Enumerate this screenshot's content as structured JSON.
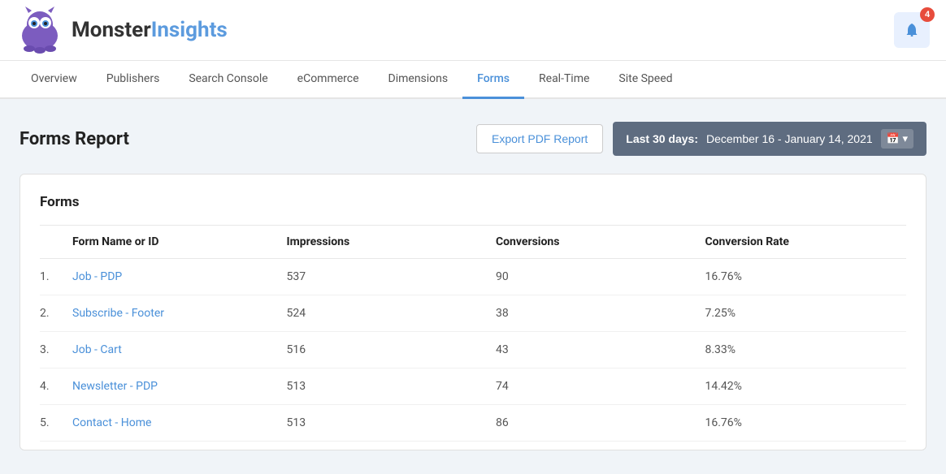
{
  "header": {
    "logo_text_plain": "Monster",
    "logo_text_accent": "Insights",
    "notification_count": "4"
  },
  "nav": {
    "items": [
      {
        "label": "Overview",
        "active": false
      },
      {
        "label": "Publishers",
        "active": false
      },
      {
        "label": "Search Console",
        "active": false
      },
      {
        "label": "eCommerce",
        "active": false
      },
      {
        "label": "Dimensions",
        "active": false
      },
      {
        "label": "Forms",
        "active": true
      },
      {
        "label": "Real-Time",
        "active": false
      },
      {
        "label": "Site Speed",
        "active": false
      }
    ]
  },
  "page": {
    "title": "Forms Report",
    "export_btn_label": "Export PDF Report",
    "date_label_bold": "Last 30 days:",
    "date_label_text": " December 16 - January 14, 2021"
  },
  "table": {
    "section_title": "Forms",
    "columns": [
      "Form Name or ID",
      "Impressions",
      "Conversions",
      "Conversion Rate"
    ],
    "rows": [
      {
        "num": "1.",
        "name": "Job - PDP",
        "impressions": "537",
        "conversions": "90",
        "rate": "16.76%"
      },
      {
        "num": "2.",
        "name": "Subscribe - Footer",
        "impressions": "524",
        "conversions": "38",
        "rate": "7.25%"
      },
      {
        "num": "3.",
        "name": "Job - Cart",
        "impressions": "516",
        "conversions": "43",
        "rate": "8.33%"
      },
      {
        "num": "4.",
        "name": "Newsletter - PDP",
        "impressions": "513",
        "conversions": "74",
        "rate": "14.42%"
      },
      {
        "num": "5.",
        "name": "Contact - Home",
        "impressions": "513",
        "conversions": "86",
        "rate": "16.76%"
      }
    ]
  },
  "icons": {
    "notification": "🔔",
    "calendar": "📅",
    "chevron_down": "▾"
  }
}
